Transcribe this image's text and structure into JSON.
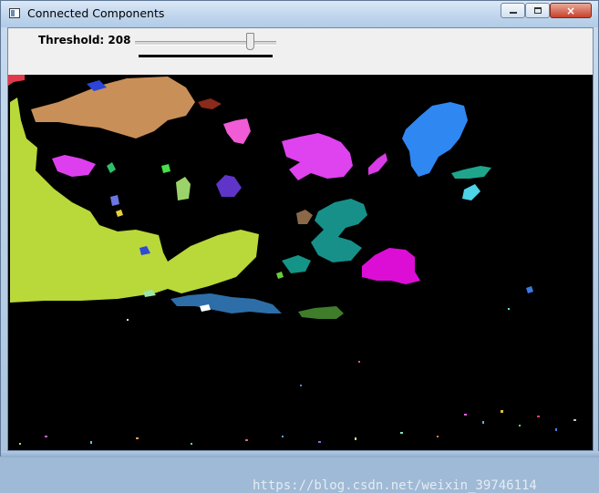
{
  "window": {
    "title": "Connected Components",
    "icon": "app-window-icon",
    "controls": {
      "minimize": "minimize-icon",
      "maximize": "maximize-icon",
      "close": "×"
    }
  },
  "toolbar": {
    "trackbar_label": "Threshold: 208",
    "trackbar_value": 208,
    "trackbar_max": 255
  },
  "watermark": "https://blog.csdn.net/weixin_39746114",
  "colors": {
    "image_background": "#000000",
    "toolbar_background": "#f0f0f0"
  }
}
